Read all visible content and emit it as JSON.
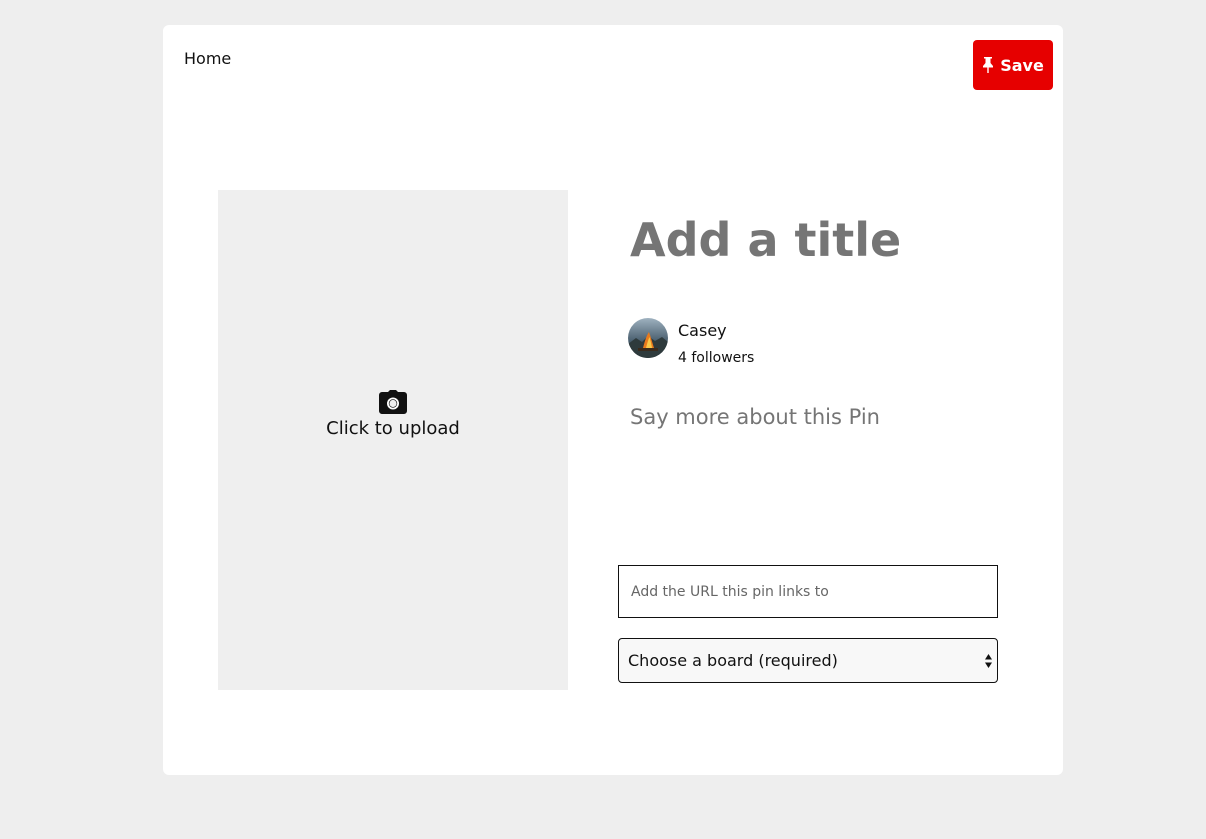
{
  "header": {
    "home_label": "Home",
    "save_label": "Save",
    "save_icon": "pin-icon"
  },
  "upload": {
    "icon": "camera-icon",
    "label": "Click to upload"
  },
  "pin": {
    "title_placeholder": "Add a title",
    "description_placeholder": "Say more about this Pin",
    "url_placeholder": "Add the URL this pin links to",
    "board_selected": "Choose a board (required)"
  },
  "author": {
    "name": "Casey",
    "followers": "4 followers"
  },
  "colors": {
    "accent": "#e60000",
    "background": "#eeeeee",
    "upload_bg": "#efefef",
    "muted_text": "#767676"
  }
}
